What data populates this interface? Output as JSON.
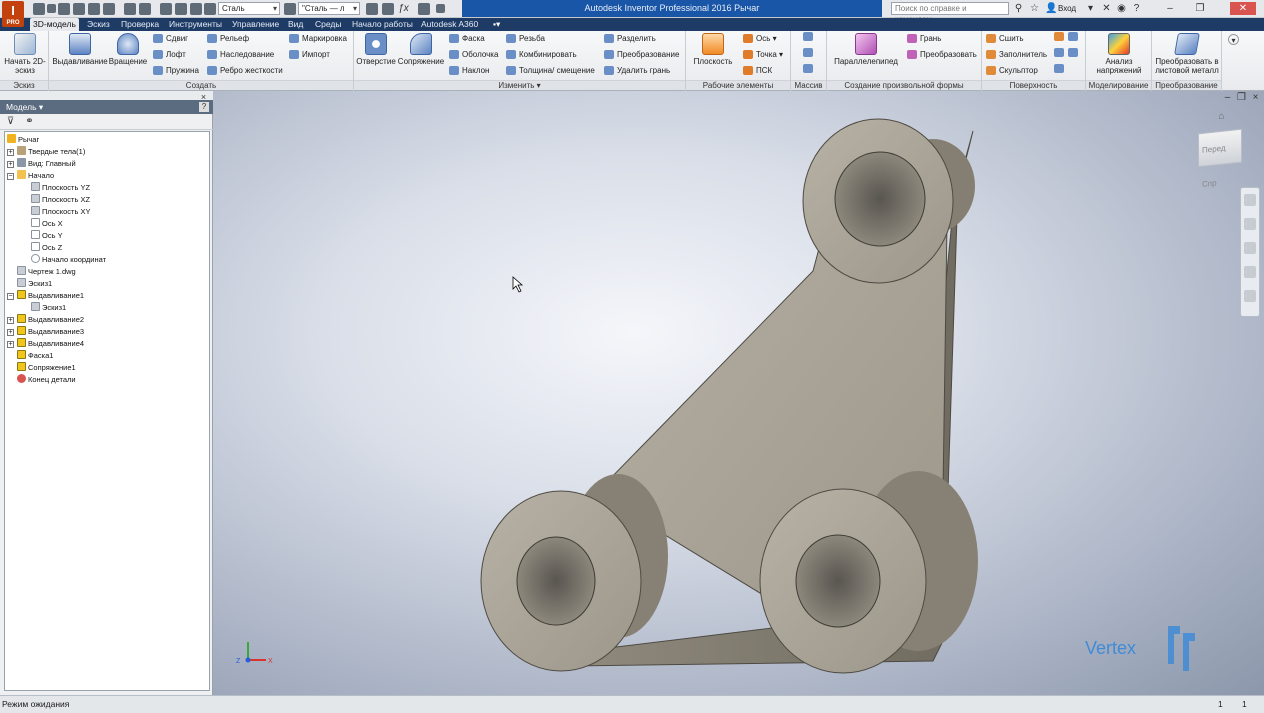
{
  "colors": {
    "accent": "#1a56a8",
    "tabbar": "#1e3b66",
    "model": "#a39e92",
    "watermark": "#3f8bd6"
  },
  "titlebar": {
    "material_value": "Сталь",
    "appearance_value": "\"Сталь — л",
    "document_title": "Autodesk Inventor Professional 2016   Рычаг",
    "help_search_placeholder": "Поиск по справке и командам...",
    "login_label": "Вход"
  },
  "tabs": [
    "3D-модель",
    "Эскиз",
    "Проверка",
    "Инструменты",
    "Управление",
    "Вид",
    "Среды",
    "Начало работы",
    "Autodesk A360"
  ],
  "ribbon": {
    "sketch": {
      "start_sketch": "Начать 2D-эскиз",
      "label": "Эскиз"
    },
    "create": {
      "extrude": "Выдавливание",
      "revolve": "Вращение",
      "sweep": "Сдвиг",
      "loft": "Лофт",
      "coil": "Пружина",
      "emboss": "Рельеф",
      "derive": "Наследование",
      "rib": "Ребро жесткости",
      "mark": "Маркировка",
      "import": "Импорт",
      "label": "Создать"
    },
    "modify": {
      "hole": "Отверстие",
      "fillet": "Сопряжение",
      "chamfer": "Фаска",
      "shell": "Оболочка",
      "draft": "Наклон",
      "thread": "Резьба",
      "combine": "Комбинировать",
      "thicken": "Толщина/ смещение",
      "split": "Разделить",
      "direct": "Преобразование",
      "delete_face": "Удалить грань",
      "label": "Изменить ▾"
    },
    "work": {
      "plane": "Плоскость",
      "axis": "Ось ▾",
      "point": "Точка ▾",
      "ucs": "ПСК",
      "label": "Рабочие элементы"
    },
    "pattern": {
      "label": "Массив"
    },
    "freeform": {
      "box": "Параллелепипед",
      "face": "Грань",
      "convert": "Преобразовать",
      "label": "Создание произвольной формы"
    },
    "surface": {
      "stitch": "Сшить",
      "patch": "Заполнитель",
      "sculpt": "Скульптор",
      "label": "Поверхность"
    },
    "simulation": {
      "stress": "Анализ напряжений",
      "label": "Моделирование"
    },
    "convert": {
      "sheet_metal": "Преобразовать в листовой металл",
      "label": "Преобразование"
    }
  },
  "browser": {
    "title": "Модель ▾",
    "nodes": [
      "Рычаг",
      "Твердые тела(1)",
      "Вид: Главный",
      "Начало",
      "Плоскость YZ",
      "Плоскость XZ",
      "Плоскость XY",
      "Ось X",
      "Ось Y",
      "Ось Z",
      "Начало координат",
      "Чертеж 1.dwg",
      "Эскиз1",
      "Выдавливание1",
      "Эскиз1",
      "Выдавливание2",
      "Выдавливание3",
      "Выдавливание4",
      "Фаска1",
      "Сопряжение1",
      "Конец детали"
    ]
  },
  "viewport": {
    "viewcube_label": "Перед Спр",
    "watermark": "Vertex"
  },
  "status": {
    "text": "Режим ожидания",
    "count_a": "1",
    "count_b": "1"
  }
}
